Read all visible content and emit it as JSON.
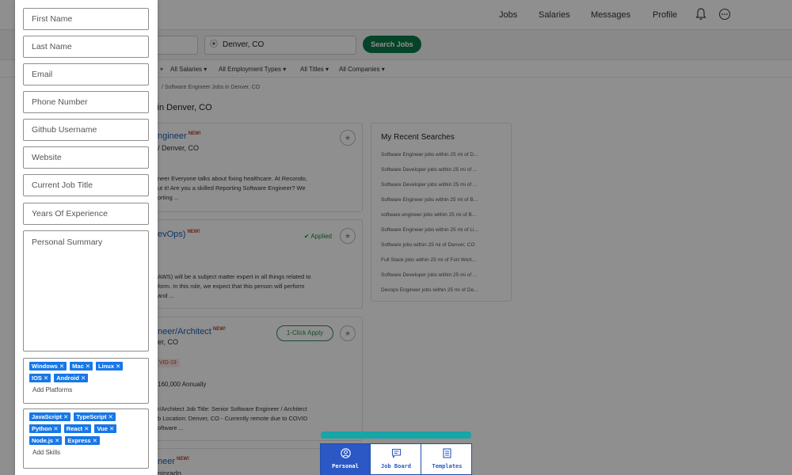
{
  "nav": {
    "links": [
      "Jobs",
      "Salaries",
      "Messages",
      "Profile"
    ],
    "bell_icon": "bell-icon",
    "more_icon": "more-circle-icon"
  },
  "search": {
    "location_value": "Denver, CO",
    "button_label": "Search Jobs"
  },
  "filters": [
    "All Salaries ▾",
    "All Employment Types ▾",
    "All Titles ▾",
    "All Companies ▾"
  ],
  "breadcrumb": "/  Software Engineer Jobs in Denver, CO",
  "results_title": "s in Denver, CO",
  "jobs": [
    {
      "title": "ngineer",
      "badge": "NEW!",
      "location": "/ Denver, CO",
      "snippet_lines": [
        "neer Everyone talks about fixing healthcare. At Recondo,",
        "ut it! Are you a skilled Reporting Software Engineer? We",
        "orting ..."
      ]
    },
    {
      "title": "evOps)",
      "badge": "NEW!",
      "status": "✔ Applied",
      "snippet_lines": [
        "AWS) will be a subject matter expert in all things related to",
        "form. In this role, we expect that this person will perform",
        "and ..."
      ]
    },
    {
      "title": "neer/Architect",
      "badge": "NEW!",
      "location": "er, CO",
      "action": "1-Click Apply",
      "covid": "VID-19",
      "salary": "160,000 Annually",
      "snippet_lines": [
        "r/Architect Job Title: Senior Software Engineer / Architect",
        "b Location: Denver, CO - Currently remote due to COVID",
        "oftware ..."
      ]
    },
    {
      "title": "neer",
      "badge": "NEW!",
      "location": "ninrado"
    }
  ],
  "recent_searches": {
    "heading": "My Recent Searches",
    "items": [
      "Software Engineer jobs within 25 mi of D...",
      "Software Developer jobs within 25 mi of ...",
      "Software Developer jobs within 25 mi of ...",
      "Software Engineer jobs within 25 mi of B...",
      "software engineer jobs within 25 mi of B...",
      "Software Engineer jobs within 25 mi of Li...",
      "Software jobs within 25 mi of Denver, CO",
      "Full Stack jobs within 25 mi of Fort Wort...",
      "Software Developer jobs within 25 mi of ...",
      "Devops Engineer jobs within 25 mi of De..."
    ]
  },
  "panel": {
    "fields": [
      {
        "name": "first-name-field",
        "placeholder": "First Name"
      },
      {
        "name": "last-name-field",
        "placeholder": "Last Name"
      },
      {
        "name": "email-field",
        "placeholder": "Email"
      },
      {
        "name": "phone-number-field",
        "placeholder": "Phone Number"
      },
      {
        "name": "github-username-field",
        "placeholder": "Github Username"
      },
      {
        "name": "website-field",
        "placeholder": "Website"
      },
      {
        "name": "current-job-title-field",
        "placeholder": "Current Job Title"
      },
      {
        "name": "years-of-experience-field",
        "placeholder": "Years Of Experience"
      }
    ],
    "summary_placeholder": "Personal Summary",
    "platforms": [
      "Windows",
      "Mac",
      "Linux",
      "IOS",
      "Android"
    ],
    "add_platforms_label": "Add Platforms",
    "skills": [
      "JavaScript",
      "TypeScript",
      "Python",
      "React",
      "Vue",
      "Node.js",
      "Express"
    ],
    "add_skills_label": "Add Skills",
    "tag_remove_glyph": "✕"
  },
  "tabs": [
    {
      "label": "Personal",
      "icon": "person-circle-icon",
      "active": true
    },
    {
      "label": "Job Board",
      "icon": "chat-list-icon",
      "active": false
    },
    {
      "label": "Templates",
      "icon": "document-icon",
      "active": false
    }
  ],
  "colors": {
    "accent_green": "#0c7a4a",
    "tag_blue": "#1877e8",
    "tab_blue": "#2b58c4",
    "progress_teal": "#18a5a7",
    "new_badge_red": "#c0392b"
  }
}
